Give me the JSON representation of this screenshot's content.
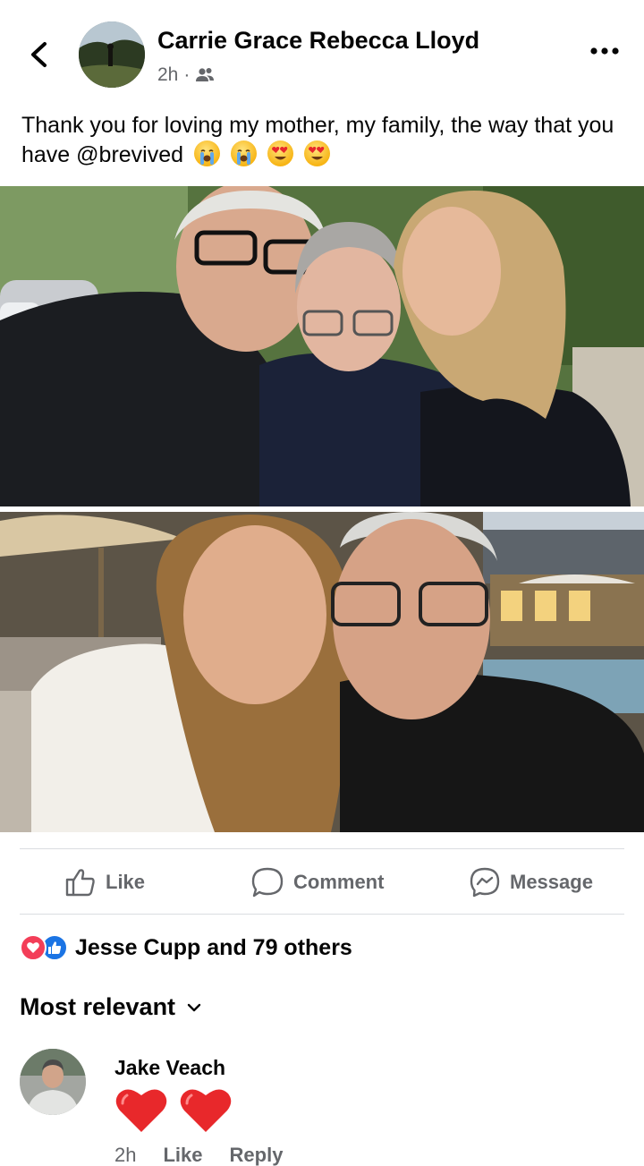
{
  "post": {
    "author": "Carrie Grace Rebecca Lloyd",
    "time": "2h",
    "separator": "·",
    "audience_icon": "friends-icon",
    "text": "Thank you for loving my mother, my family, the way that you have @brevived",
    "emojis": [
      "loudly-crying-face",
      "loudly-crying-face",
      "heart-eyes-face",
      "heart-eyes-face"
    ]
  },
  "actions": {
    "like": "Like",
    "comment": "Comment",
    "message": "Message"
  },
  "reactions": {
    "summary": "Jesse Cupp and 79 others",
    "icons": [
      "love-reaction-icon",
      "like-reaction-icon"
    ]
  },
  "comments": {
    "sort_label": "Most relevant",
    "items": [
      {
        "name": "Jake Veach",
        "content_emoji": [
          "red-heart",
          "red-heart"
        ],
        "time": "2h",
        "like": "Like",
        "reply": "Reply"
      }
    ]
  },
  "colors": {
    "text_primary": "#050505",
    "text_secondary": "#65676b",
    "divider": "#dadde1",
    "love": "#f33e58",
    "like": "#1b74e4",
    "heart": "#e8282b"
  }
}
